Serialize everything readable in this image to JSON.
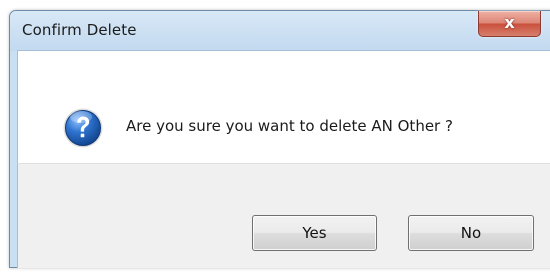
{
  "dialog": {
    "title": "Confirm Delete",
    "close_label": "x",
    "message": "Are you sure you want to delete AN Other ?",
    "icon": "question-icon",
    "buttons": {
      "yes_label": "Yes",
      "no_label": "No"
    }
  },
  "colors": {
    "titlebar": "#c9dff2",
    "close_button": "#d67f6d",
    "icon_blue": "#1f5fb5",
    "footer": "#f0f0f0"
  }
}
